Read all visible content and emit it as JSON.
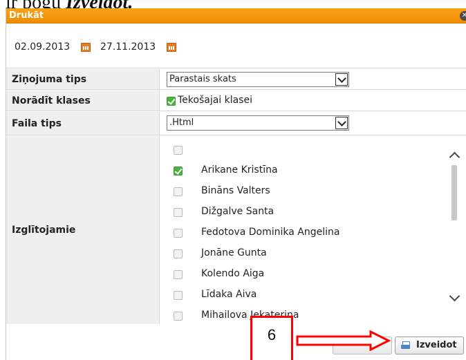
{
  "doc_text": {
    "prefix": "ir pogu ",
    "bold": "Izveidot."
  },
  "dialog": {
    "title": "Drukāt",
    "date_from": "02.09.2013",
    "date_to": "27.11.2013",
    "report_type": {
      "label": "Ziņojuma tips",
      "value": "Parastais skats"
    },
    "classes": {
      "label": "Norādīt klases",
      "option": "Tekošajai klasei",
      "checked": true
    },
    "file_type": {
      "label": "Faila tips",
      "value": ".Html"
    },
    "students": {
      "label": "Izglītojamie",
      "items": [
        {
          "name": "",
          "checked": false
        },
        {
          "name": "Arikane Kristīna",
          "checked": true
        },
        {
          "name": "Bināns Valters",
          "checked": false
        },
        {
          "name": "Dižgalve Santa",
          "checked": false
        },
        {
          "name": "Fedotova Dominika Angelina",
          "checked": false
        },
        {
          "name": "Jonāne Gunta",
          "checked": false
        },
        {
          "name": "Kolendo Aiga",
          "checked": false
        },
        {
          "name": "Līdaka Aiva",
          "checked": false
        },
        {
          "name": "Mihailova Jekaterina",
          "checked": false
        }
      ]
    },
    "create_button": "Izveidot"
  },
  "callout": {
    "number": "6"
  },
  "colors": {
    "title_bar": "#ee8d00",
    "callout": "#ff0000",
    "checkbox_checked": "#48b33e"
  }
}
